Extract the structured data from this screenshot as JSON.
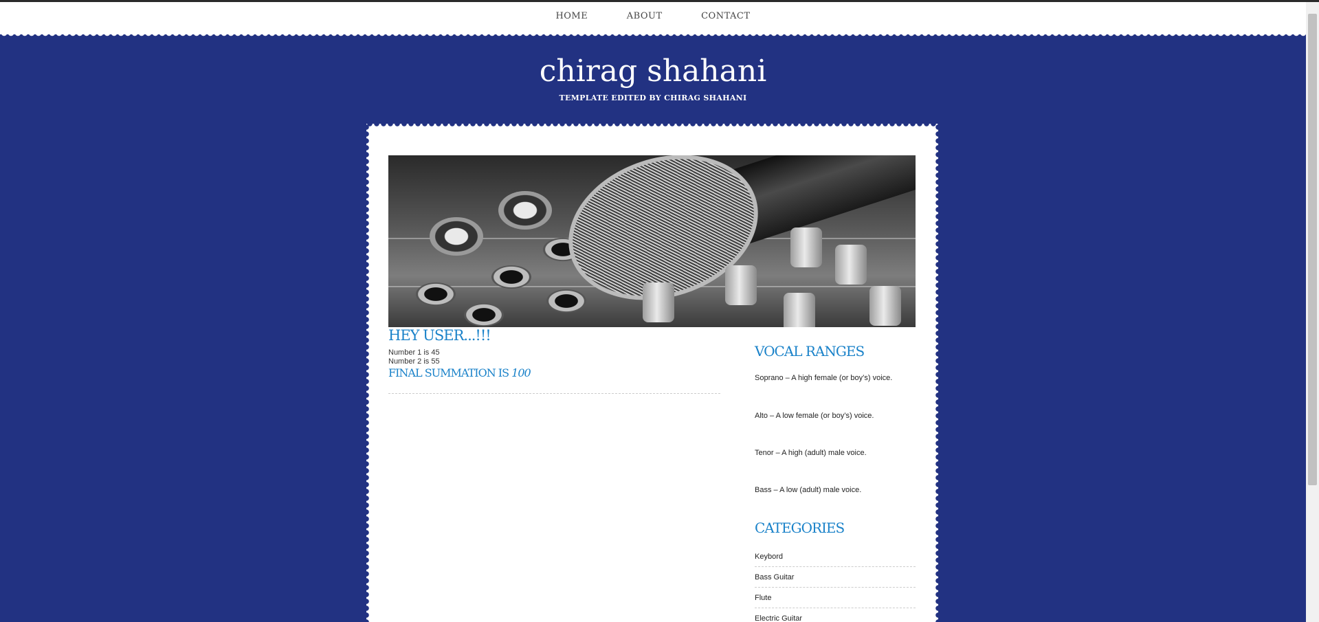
{
  "nav": {
    "items": [
      {
        "label": "HOME"
      },
      {
        "label": "ABOUT"
      },
      {
        "label": "CONTACT"
      }
    ]
  },
  "header": {
    "title": "chirag shahani",
    "subtitle": "TEMPLATE EDITED BY CHIRAG SHAHANI"
  },
  "post": {
    "title": "HEY USER...!!!",
    "lines": [
      "Number 1 is 45",
      "Number 2 is 55"
    ],
    "summation_label": "FINAL SUMMATION IS",
    "summation_value": "100"
  },
  "sidebar": {
    "vocal_ranges": {
      "title": "VOCAL RANGES",
      "items": [
        "Soprano – A high female (or boy’s) voice.",
        "Alto – A low female (or boy’s) voice.",
        "Tenor – A high (adult) male voice.",
        "Bass – A low (adult) male voice."
      ]
    },
    "categories": {
      "title": "CATEGORIES",
      "items": [
        "Keybord",
        "Bass Guitar",
        "Flute",
        "Electric Guitar"
      ]
    }
  },
  "colors": {
    "background": "#223282",
    "accent": "#1a82c9",
    "card": "#ffffff"
  }
}
